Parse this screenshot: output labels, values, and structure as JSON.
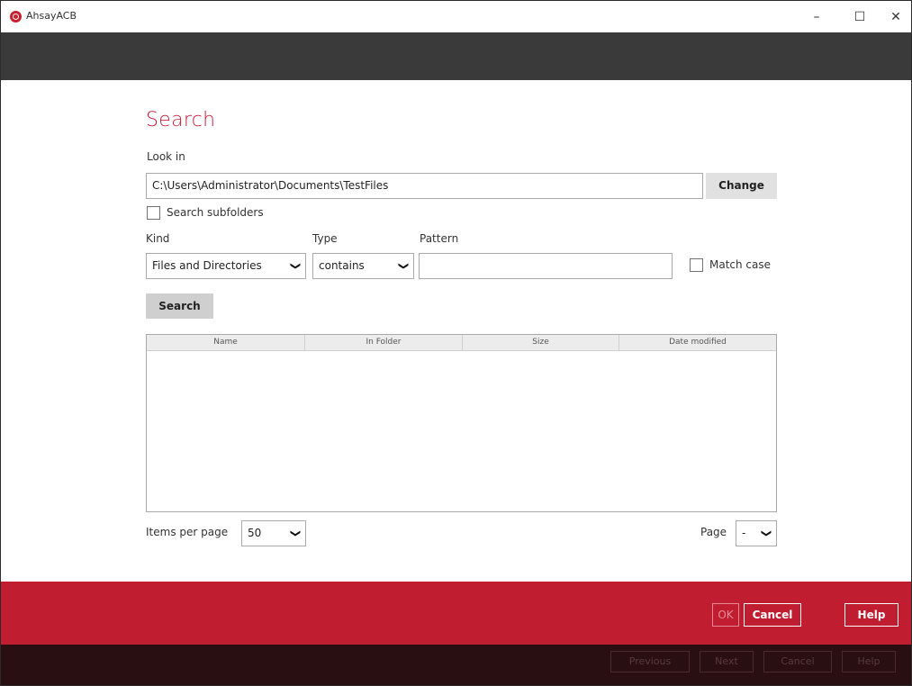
{
  "window": {
    "title": "AhsayACB",
    "minimize": "–",
    "maximize": "☐",
    "close": "✕"
  },
  "dialog": {
    "heading": "Search",
    "look_in_label": "Look in",
    "look_in_value": "C:\\Users\\Administrator\\Documents\\TestFiles",
    "change_label": "Change",
    "search_subfolders_label": "Search subfolders",
    "kind_label": "Kind",
    "type_label": "Type",
    "pattern_label": "Pattern",
    "kind_value": "Files and Directories",
    "type_value": "contains",
    "pattern_value": "",
    "match_case_label": "Match case",
    "search_button": "Search",
    "columns": [
      "Name",
      "In Folder",
      "Size",
      "Date modified"
    ],
    "items_per_page_label": "Items per page",
    "items_per_page_value": "50",
    "page_label": "Page",
    "page_value": "-"
  },
  "footer": {
    "ok": "OK",
    "cancel": "Cancel",
    "help": "Help",
    "ghost_previous": "Previous",
    "ghost_next": "Next",
    "ghost_cancel": "Cancel",
    "ghost_help": "Help"
  },
  "colors": {
    "accent": "#c8203a",
    "footer_red": "#c01e30",
    "header_dark": "#3a3a3a"
  }
}
